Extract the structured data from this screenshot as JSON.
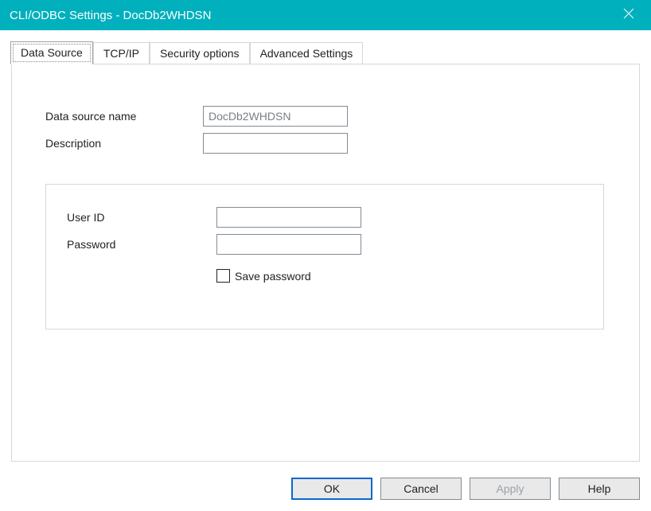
{
  "window": {
    "title": "CLI/ODBC Settings - DocDb2WHDSN"
  },
  "tabs": {
    "dataSource": "Data Source",
    "tcpip": "TCP/IP",
    "security": "Security options",
    "advanced": "Advanced Settings",
    "active": "dataSource"
  },
  "fields": {
    "dsn": {
      "label": "Data source name",
      "value": "DocDb2WHDSN",
      "disabled": true
    },
    "description": {
      "label": "Description",
      "value": ""
    },
    "user": {
      "label": "User ID",
      "value": ""
    },
    "password": {
      "label": "Password",
      "value": ""
    },
    "savePassword": {
      "label": "Save password",
      "checked": false
    }
  },
  "buttons": {
    "ok": "OK",
    "cancel": "Cancel",
    "apply": "Apply",
    "help": "Help",
    "applyEnabled": false
  }
}
